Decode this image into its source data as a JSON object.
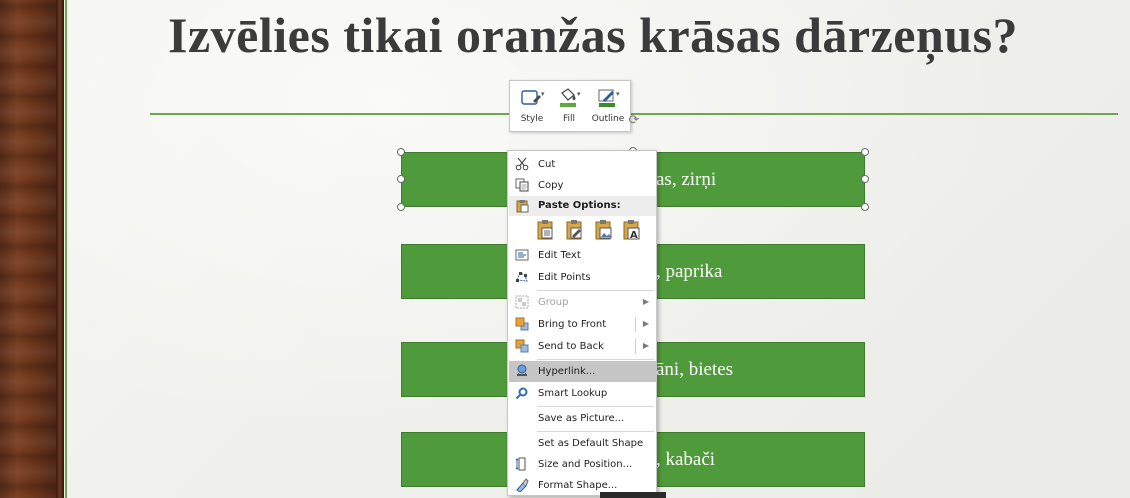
{
  "slide": {
    "title": "Izvēlies tikai oranžas krāsas dārzeņus?",
    "accent_color": "#6ea64b",
    "shape_color": "#4f9a3a",
    "shapes": [
      {
        "text": "as, zirņi"
      },
      {
        "text": ", paprika"
      },
      {
        "text": "āni, bietes"
      },
      {
        "text": ", kabači"
      }
    ]
  },
  "mini_toolbar": {
    "style_label": "Style",
    "fill_label": "Fill",
    "outline_label": "Outline",
    "style_icon": "shape-style-icon",
    "fill_icon": "paint-bucket-icon",
    "outline_icon": "pen-outline-icon"
  },
  "context_menu": {
    "cut": "Cut",
    "copy": "Copy",
    "paste_options": "Paste Options:",
    "edit_text": "Edit Text",
    "edit_points": "Edit Points",
    "group": "Group",
    "bring_to_front": "Bring to Front",
    "send_to_back": "Send to Back",
    "hyperlink": "Hyperlink...",
    "smart_lookup": "Smart Lookup",
    "save_as_picture": "Save as Picture...",
    "set_default_shape": "Set as Default Shape",
    "size_and_position": "Size and Position...",
    "format_shape": "Format Shape..."
  }
}
